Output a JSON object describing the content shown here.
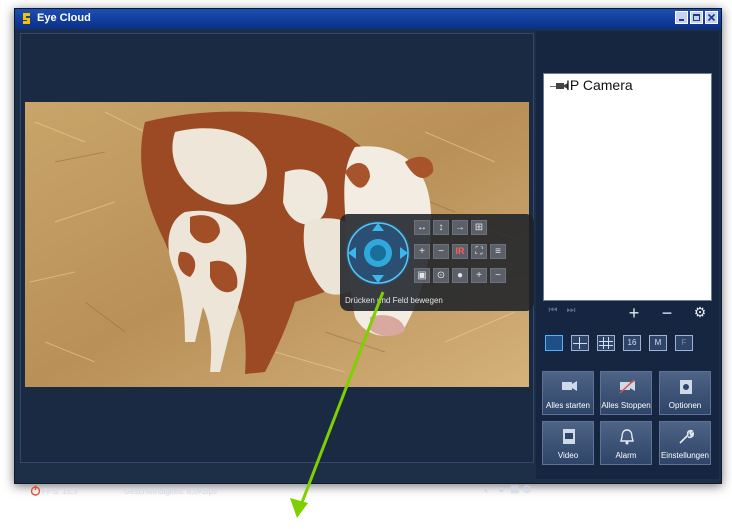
{
  "window": {
    "title": "Eye Cloud"
  },
  "ptz": {
    "hint": "Drücken und Feld bewegen",
    "ir_label": "IR"
  },
  "status": {
    "fps": "FPS: 15,3",
    "speed": "Geschwindigkeit: 8,0KBps"
  },
  "tree": {
    "camera": "IP Camera"
  },
  "layouts": [
    "",
    "",
    "",
    "16",
    "M",
    "F"
  ],
  "actions": [
    {
      "label": "Alles starten",
      "icon": "camera-start-icon"
    },
    {
      "label": "Alles Stoppen",
      "icon": "camera-stop-icon"
    },
    {
      "label": "Optionen",
      "icon": "options-icon"
    },
    {
      "label": "Video",
      "icon": "video-file-icon"
    },
    {
      "label": "Alarm",
      "icon": "alarm-bell-icon"
    },
    {
      "label": "Einstellungen",
      "icon": "wrench-icon"
    }
  ],
  "colors": {
    "titlebar": "#0a2f86",
    "background": "#1d2e47",
    "arrow": "#7fd000"
  }
}
